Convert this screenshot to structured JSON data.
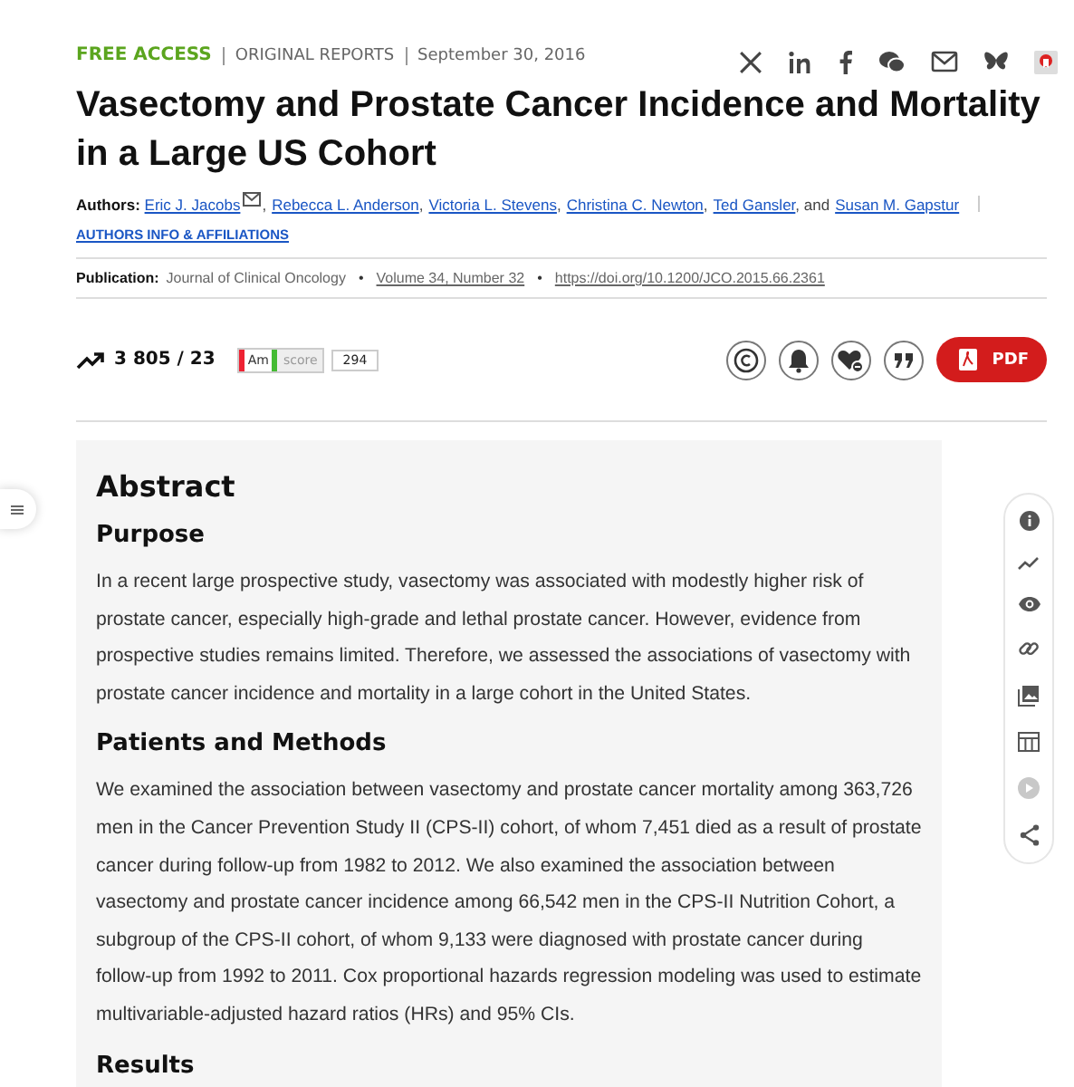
{
  "meta": {
    "access": "FREE ACCESS",
    "type": "ORIGINAL REPORTS",
    "date": "September 30, 2016"
  },
  "title": "Vasectomy and Prostate Cancer Incidence and Mortality in a Large US Cohort",
  "authors": {
    "label": "Authors:",
    "list": [
      {
        "name": "Eric J. Jacobs",
        "contact": true,
        "separator": ","
      },
      {
        "name": "Rebecca L. Anderson",
        "contact": false,
        "separator": ","
      },
      {
        "name": "Victoria L. Stevens",
        "contact": false,
        "separator": ","
      },
      {
        "name": "Christina C. Newton",
        "contact": false,
        "separator": ","
      },
      {
        "name": "Ted Gansler",
        "contact": false,
        "separator": ", and"
      },
      {
        "name": "Susan M. Gapstur",
        "contact": false
      }
    ],
    "info_link": "AUTHORS INFO & AFFILIATIONS"
  },
  "publication": {
    "label": "Publication:",
    "journal": "Journal of Clinical Oncology",
    "bullet": "•",
    "volume": "Volume 34, Number 32",
    "doi": "https://doi.org/10.1200/JCO.2015.66.2361"
  },
  "metrics": {
    "views": "3 805 / 23",
    "altmetric": {
      "logo": "Am",
      "label": "score",
      "value": "294"
    }
  },
  "pdf": "PDF",
  "abstract": {
    "title": "Abstract",
    "sections": [
      {
        "heading": "Purpose",
        "text": "In a recent large prospective study, vasectomy was associated with modestly higher risk of prostate cancer, especially high-grade and lethal prostate cancer. However, evidence from prospective studies remains limited. Therefore, we assessed the associations of vasectomy with prostate cancer incidence and mortality in a large cohort in the United States."
      },
      {
        "heading": "Patients and Methods",
        "text": "We examined the association between vasectomy and prostate cancer mortality among 363,726 men in the Cancer Prevention Study II (CPS-II) cohort, of whom 7,451 died as a result of prostate cancer during follow-up from 1982 to 2012. We also examined the association between vasectomy and prostate cancer incidence among 66,542 men in the CPS-II Nutrition Cohort, a subgroup of the CPS-II cohort, of whom 9,133 were diagnosed with prostate cancer during follow-up from 1992 to 2011. Cox proportional hazards regression modeling was used to estimate multivariable-adjusted hazard ratios (HRs) and 95% CIs."
      },
      {
        "heading": "Results"
      }
    ]
  }
}
